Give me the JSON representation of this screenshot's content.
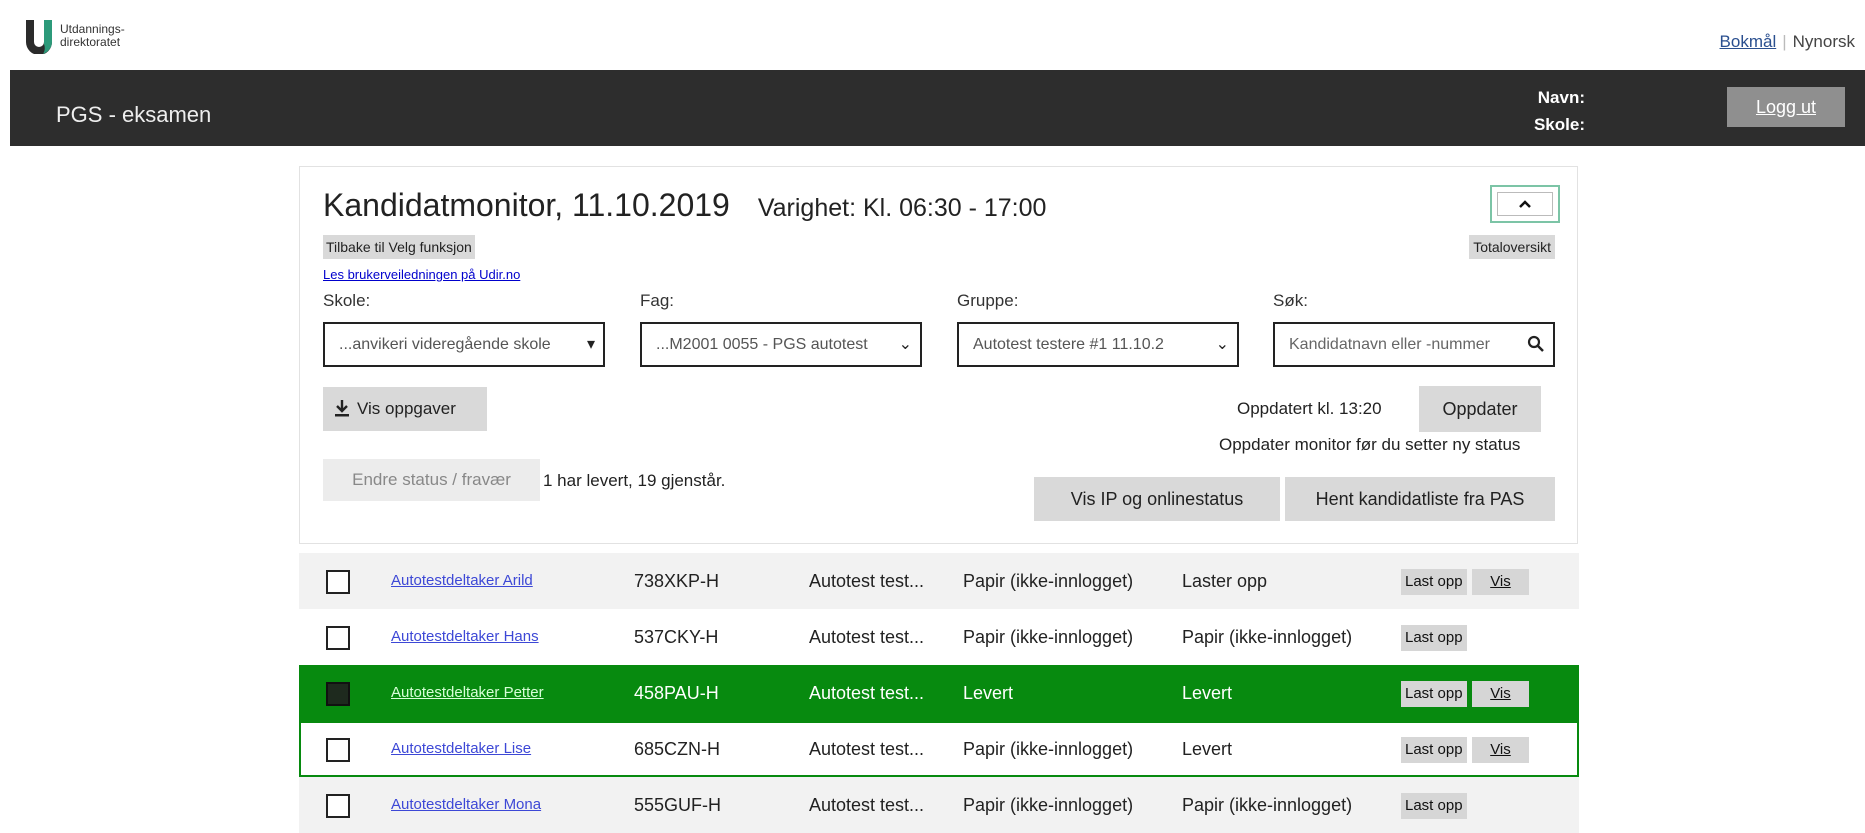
{
  "brand": {
    "logo_line1": "Utdannings-",
    "logo_line2": "direktoratet"
  },
  "language": {
    "bokmal": "Bokmål",
    "nynorsk": "Nynorsk"
  },
  "header": {
    "app_title": "PGS - eksamen",
    "navn_label": "Navn:",
    "skole_label": "Skole:",
    "logout_label": "Logg ut"
  },
  "monitor": {
    "title": "Kandidatmonitor, 11.10.2019",
    "duration": "Varighet: Kl. 06:30 - 17:00",
    "collapse_icon": "chevron-up",
    "back_label": "Tilbake til Velg funksjon",
    "total_label": "Totaloversikt",
    "guide_link": "Les brukerveiledningen på Udir.no",
    "filters": {
      "skole_label": "Skole:",
      "skole_value": "...anvikeri videregående skole",
      "fag_label": "Fag:",
      "fag_value": "...M2001 0055 - PGS autotest",
      "gruppe_label": "Gruppe:",
      "gruppe_value": "Autotest testere #1 11.10.2",
      "sok_label": "Søk:",
      "sok_placeholder": "Kandidatnavn eller -nummer"
    },
    "vis_oppgaver": "Vis oppgaver",
    "updated_text": "Oppdatert kl. 13:20",
    "update_button": "Oppdater",
    "update_hint": "Oppdater monitor før du setter ny status",
    "status_button": "Endre status / fravær",
    "count_text": "1 har levert, 19 gjenstår.",
    "ip_button": "Vis IP og onlinestatus",
    "pas_button": "Hent kandidatliste fra PAS"
  },
  "candidates": [
    {
      "name": "Autotestdeltaker Arild",
      "number": "738XKP-H",
      "group": "Autotest test...",
      "status1": "Papir (ikke-innlogget)",
      "status2": "Laster opp",
      "last_opp": "Last opp",
      "vis": "Vis"
    },
    {
      "name": "Autotestdeltaker Hans",
      "number": "537CKY-H",
      "group": "Autotest test...",
      "status1": "Papir (ikke-innlogget)",
      "status2": "Papir (ikke-innlogget)",
      "last_opp": "Last opp",
      "vis": ""
    },
    {
      "name": "Autotestdeltaker Petter",
      "number": "458PAU-H",
      "group": "Autotest test...",
      "status1": "Levert",
      "status2": "Levert",
      "last_opp": "Last opp",
      "vis": "Vis"
    },
    {
      "name": "Autotestdeltaker Lise",
      "number": "685CZN-H",
      "group": "Autotest test...",
      "status1": "Papir (ikke-innlogget)",
      "status2": "Levert",
      "last_opp": "Last opp",
      "vis": "Vis"
    },
    {
      "name": "Autotestdeltaker Mona",
      "number": "555GUF-H",
      "group": "Autotest test...",
      "status1": "Papir (ikke-innlogget)",
      "status2": "Papir (ikke-innlogget)",
      "last_opp": "Last opp",
      "vis": ""
    }
  ],
  "colors": {
    "header_bg": "#2d2d2d",
    "delivered_row": "#078a0f",
    "accent_border": "#7cc4a6"
  }
}
